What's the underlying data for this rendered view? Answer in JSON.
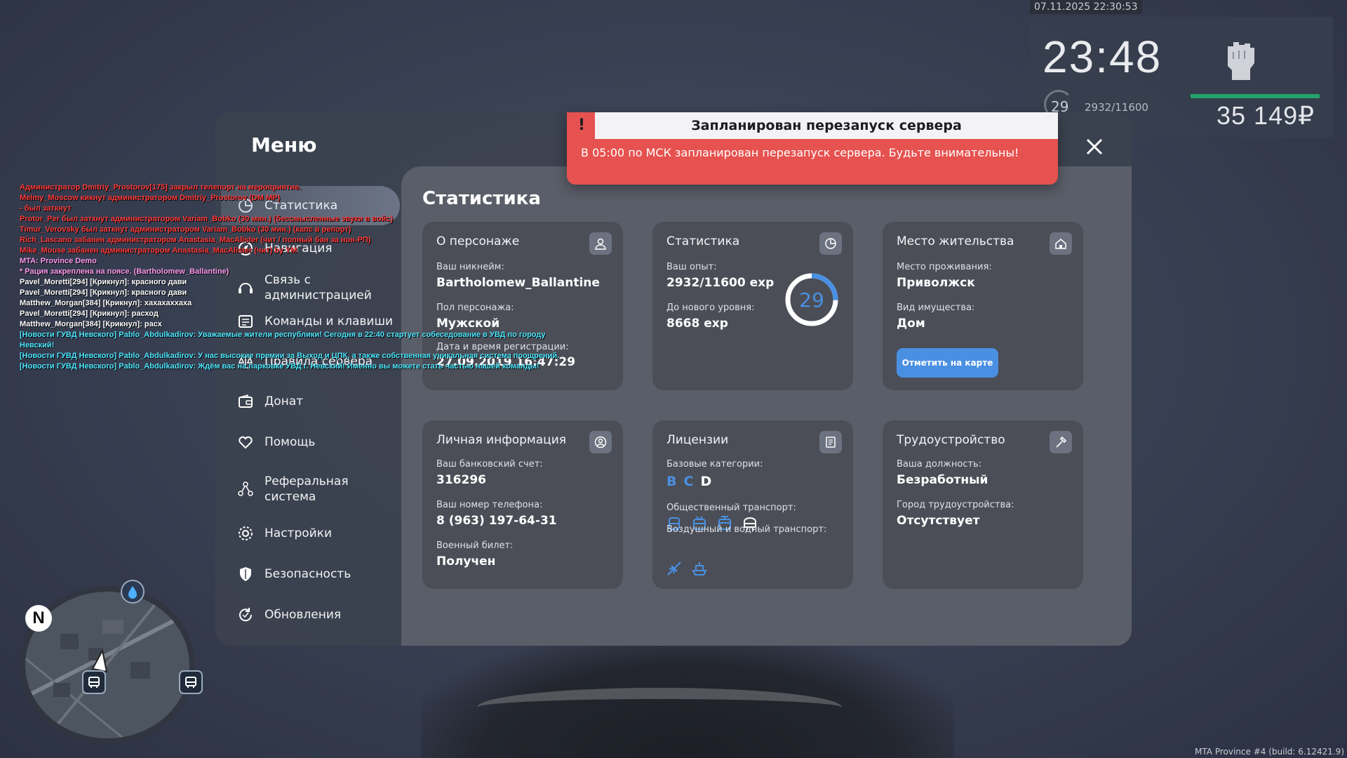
{
  "hud": {
    "timestamp": "07.11.2025 22:30:53",
    "clock": "23:48",
    "level": "29",
    "exp": "2932/11600",
    "money": "35 149₽",
    "health_fraction": 1.0
  },
  "menu": {
    "title": "Меню",
    "items": [
      {
        "label": "Статистика",
        "icon": "pie-chart-icon",
        "active": true
      },
      {
        "label": "Навигация",
        "icon": "compass-icon"
      },
      {
        "label": "Связь с администрацией",
        "icon": "headset-icon"
      },
      {
        "label": "Команды и клавиши",
        "icon": "keyboard-icon"
      },
      {
        "label": "Правила сервера",
        "icon": "scales-icon"
      },
      {
        "label": "Донат",
        "icon": "wallet-icon"
      },
      {
        "label": "Помощь",
        "icon": "heart-hand-icon"
      },
      {
        "label": "Реферальная система",
        "icon": "network-icon"
      },
      {
        "label": "Настройки",
        "icon": "gear-icon"
      },
      {
        "label": "Безопасность",
        "icon": "shield-icon"
      },
      {
        "label": "Обновления",
        "icon": "refresh-icon"
      }
    ]
  },
  "content": {
    "title": "Статистика",
    "character": {
      "title": "О персонаже",
      "nickname_label": "Ваш никнейм:",
      "nickname": "Bartholomew_Ballantine",
      "gender_label": "Пол персонажа:",
      "gender": "Мужской",
      "reg_label": "Дата и время регистрации:",
      "reg_date": "27.09.2019 16:47:29"
    },
    "stats": {
      "title": "Статистика",
      "exp_label": "Ваш опыт:",
      "exp": "2932/11600 exp",
      "next_label": "До нового уровня:",
      "next": "8668 exp",
      "level": "29",
      "level_progress": 0.253
    },
    "residence": {
      "title": "Место жительства",
      "place_label": "Место проживания:",
      "place": "Приволжск",
      "type_label": "Вид имущества:",
      "type": "Дом",
      "button": "Отметить на карте"
    },
    "personal": {
      "title": "Личная информация",
      "bank_label": "Ваш банковский счет:",
      "bank": "316296",
      "phone_label": "Ваш номер телефона:",
      "phone": "8 (963) 197-64-31",
      "military_label": "Военный билет:",
      "military": "Получен"
    },
    "licenses": {
      "title": "Лицензии",
      "base_label": "Базовые категории:",
      "categories": [
        "B",
        "C",
        "D"
      ],
      "public_label": "Общественный транспорт:",
      "public_icons": [
        "bus-icon",
        "trolleybus-icon",
        "tram-icon",
        "metro-icon"
      ],
      "air_label": "Воздушный и водный транспорт:",
      "air_icons": [
        "plane-icon",
        "boat-icon"
      ]
    },
    "job": {
      "title": "Трудоустройство",
      "position_label": "Ваша должность:",
      "position": "Безработный",
      "city_label": "Город трудоустройства:",
      "city": "Отсутствует"
    }
  },
  "notification": {
    "title": "Запланирован перезапуск сервера",
    "body": "В 05:00 по МСК запланирован перезапуск сервера. Будьте внимательны!",
    "mark": "!"
  },
  "chat": [
    {
      "text": "Администратор Dmitriy_Prostorov[175] закрыл телепорт на мероприятие.",
      "color": "#ff3b3b"
    },
    {
      "text": "Melmy_Moscow кикнут администратором Dmitriy_Prostorov (DM MP)",
      "color": "#ff3b3b"
    },
    {
      "text": "- был заткнут",
      "color": "#ff3b3b"
    },
    {
      "text": "Protor_Per был заткнут администратором Variam_Bobko (30 мин.) (бессмысленные звуки в войс)",
      "color": "#ff3b3b"
    },
    {
      "text": "Timur_Verovsky был заткнут администратором Variam_Bobko (30 мин.) (капс в репорт)",
      "color": "#ff3b3b"
    },
    {
      "text": "Rich_Lascano забанен администратором Anastasia_MacAlister (чит / полный бан за нон-РП)",
      "color": "#ff3b3b"
    },
    {
      "text": "Mike_Mouse забанен администратором Anastasia_MacAlister (чит) by YM",
      "color": "#ff3b3b"
    },
    {
      "text": "MTA: Province Demo",
      "color": "#ff9cf0"
    },
    {
      "text": "* Рация закреплена на поясе. (Bartholomew_Ballantine)",
      "color": "#ff9cf0"
    },
    {
      "text": "Pavel_Moretti[294] [Крикнул]: красного дави",
      "color": "#ffffff"
    },
    {
      "text": "Pavel_Moretti[294] [Крикнул]: красного дави",
      "color": "#ffffff"
    },
    {
      "text": "Matthew_Morgan[384] [Крикнул]: хахахаххаха",
      "color": "#ffffff"
    },
    {
      "text": "Pavel_Moretti[294] [Крикнул]: расход",
      "color": "#ffffff"
    },
    {
      "text": "Matthew_Morgan[384] [Крикнул]: расх",
      "color": "#ffffff"
    },
    {
      "text": "[Новости ГУВД Невского] Pablo_Abdulkadirov: Уважаемые жители республики! Сегодня в 22:40 стартует собеседование в УВД по городу Невский!",
      "color": "#4ee8ff"
    },
    {
      "text": "[Новости ГУВД Невского] Pablo_Abdulkadirov: У нас высокие премии за Выход и ЦПК, а также собственная уникальная система поощрений.",
      "color": "#4ee8ff"
    },
    {
      "text": "[Новости ГУВД Невского] Pablo_Abdulkadirov: Ждём вас на парковке УВД г. Невский! Именно вы можете стать частью нашей команды!",
      "color": "#4ee8ff"
    }
  ],
  "minimap": {
    "north": "N"
  },
  "build": "MTA Province #4 (build: 6.12421.9)",
  "colors": {
    "accent": "#4a90e2",
    "notification": "#e6524f",
    "health": "#23a36b"
  }
}
